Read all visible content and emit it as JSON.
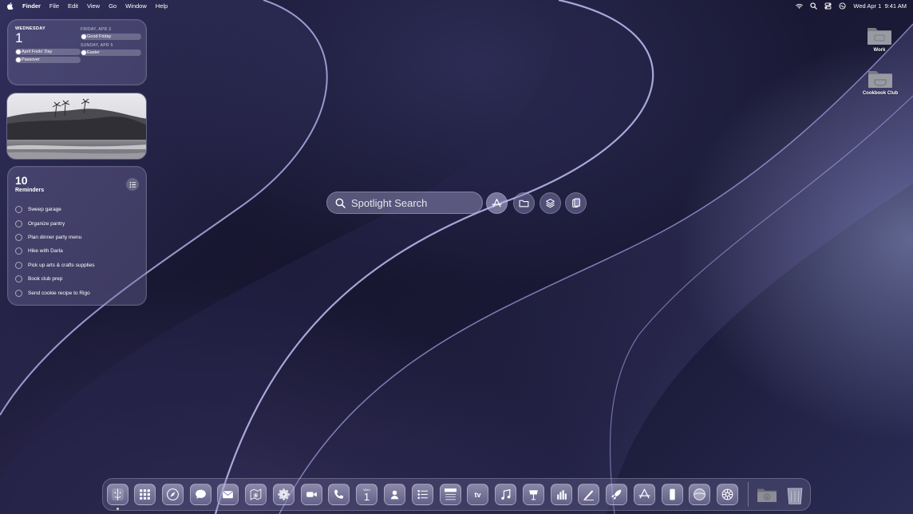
{
  "menubar": {
    "app_name": "Finder",
    "menus": [
      "File",
      "Edit",
      "View",
      "Go",
      "Window",
      "Help"
    ],
    "datetime": "Wed Apr 1  9:41 AM",
    "status_icons": [
      "wifi-icon",
      "search-icon",
      "control-center-icon",
      "siri-icon"
    ]
  },
  "calendar_widget": {
    "weekday": "WEDNESDAY",
    "day_number": "1",
    "today_events": [
      "April Fools' Day",
      "Passover"
    ],
    "upcoming": [
      {
        "heading": "FRIDAY, APR 3",
        "event": "Good Friday"
      },
      {
        "heading": "SUNDAY, APR 5",
        "event": "Easter"
      }
    ]
  },
  "photo_widget": {
    "subject": "beach-with-palm-trees"
  },
  "reminders_widget": {
    "count": "10",
    "title": "Reminders",
    "items": [
      "Sweep garage",
      "Organize pantry",
      "Plan dinner party menu",
      "Hike with Darla",
      "Pick up arts & crafts supplies",
      "Book club prep",
      "Send cookie recipe to Rigo"
    ]
  },
  "spotlight": {
    "placeholder": "Spotlight Search",
    "buttons": [
      "applications-icon",
      "files-icon",
      "actions-icon",
      "clipboard-icon"
    ]
  },
  "desktop": {
    "folders": [
      {
        "label": "Work"
      },
      {
        "label": "Cookbook Club"
      }
    ]
  },
  "dock": {
    "apps": [
      "finder-icon",
      "launchpad-icon",
      "safari-icon",
      "messages-icon",
      "mail-icon",
      "maps-icon",
      "photos-icon",
      "facetime-icon",
      "phone-icon",
      "calendar-icon",
      "contacts-icon",
      "reminders-icon",
      "notes-icon",
      "tv-icon",
      "music-icon",
      "keynote-icon",
      "numbers-icon",
      "pages-icon",
      "rocket-icon",
      "app-store-icon",
      "iphone-mirroring-icon",
      "quicktime-icon",
      "settings-icon"
    ],
    "calendar_icon": {
      "month": "Wed",
      "day": "1"
    },
    "tv_label": "tv",
    "right_items": [
      "downloads-folder-icon",
      "trash-icon"
    ]
  },
  "colors": {
    "accent": "#8f8ad0",
    "background": "#1b1a38"
  }
}
